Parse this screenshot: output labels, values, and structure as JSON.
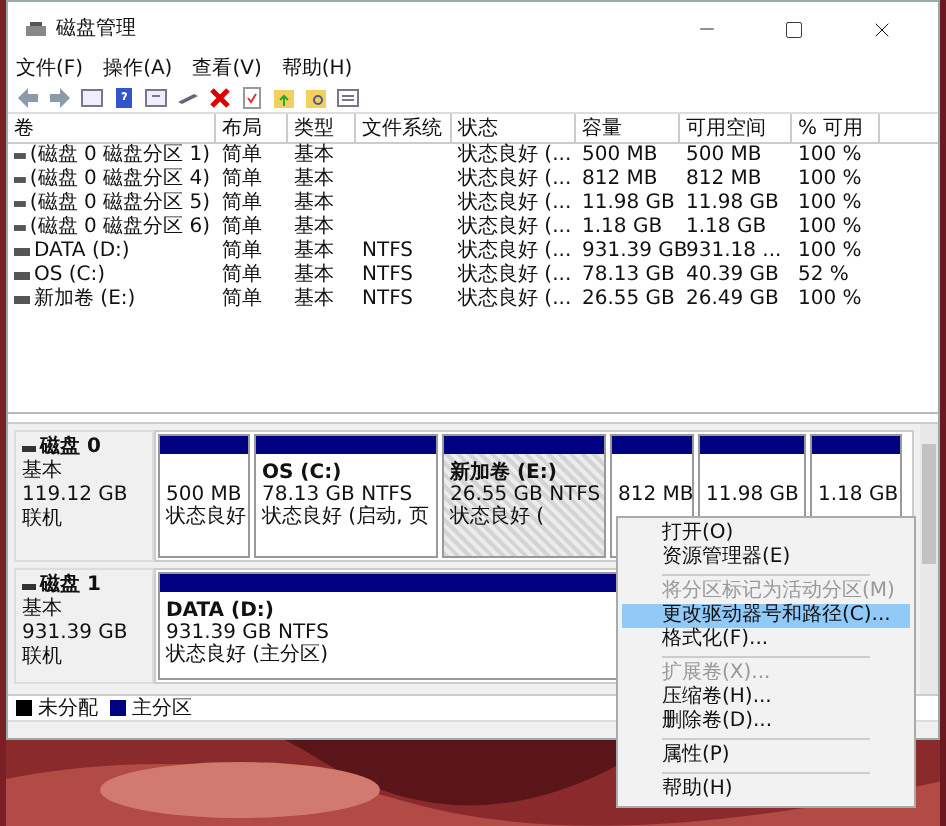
{
  "window": {
    "title": "磁盘管理"
  },
  "menu": [
    "文件(F)",
    "操作(A)",
    "查看(V)",
    "帮助(H)"
  ],
  "table": {
    "columns": [
      "卷",
      "布局",
      "类型",
      "文件系统",
      "状态",
      "容量",
      "可用空间",
      "% 可用"
    ],
    "rows": [
      {
        "volume": "(磁盘 0 磁盘分区 1)",
        "layout": "简单",
        "type": "基本",
        "status": "状态良好 (...",
        "capacity": "500 MB",
        "free": "500 MB",
        "percent": "100 %"
      },
      {
        "volume": "(磁盘 0 磁盘分区 4)",
        "layout": "简单",
        "type": "基本",
        "status": "状态良好 (...",
        "capacity": "812 MB",
        "free": "812 MB",
        "percent": "100 %"
      },
      {
        "volume": "(磁盘 0 磁盘分区 5)",
        "layout": "简单",
        "type": "基本",
        "status": "状态良好 (...",
        "capacity": "11.98 GB",
        "free": "11.98 GB",
        "percent": "100 %"
      },
      {
        "volume": "(磁盘 0 磁盘分区 6)",
        "layout": "简单",
        "type": "基本",
        "status": "状态良好 (...",
        "capacity": "1.18 GB",
        "free": "1.18 GB",
        "percent": "100 %"
      },
      {
        "volume": "DATA (D:)",
        "layout": "简单",
        "type": "基本",
        "file_system": "NTFS",
        "status": "状态良好 (...",
        "capacity": "931.39 GB",
        "free": "931.18 ...",
        "percent": "100 %"
      },
      {
        "volume": "OS (C:)",
        "layout": "简单",
        "type": "基本",
        "file_system": "NTFS",
        "status": "状态良好 (...",
        "capacity": "78.13 GB",
        "free": "40.39 GB",
        "percent": "52 %"
      },
      {
        "volume": "新加卷 (E:)",
        "layout": "简单",
        "type": "基本",
        "file_system": "NTFS",
        "status": "状态良好 (...",
        "capacity": "26.55 GB",
        "free": "26.49 GB",
        "percent": "100 %"
      }
    ]
  },
  "disks": [
    {
      "name": "磁盘 0",
      "type": "基本",
      "size": "119.12 GB",
      "state": "联机",
      "partitions": [
        {
          "lines": [
            "500 MB",
            "状态良好"
          ],
          "selected": false
        },
        {
          "title": "OS  (C:)",
          "lines": [
            "78.13 GB NTFS",
            "状态良好 (启动, 页"
          ],
          "selected": false
        },
        {
          "title": "新加卷  (E:)",
          "lines": [
            "26.55 GB NTFS",
            "状态良好 ("
          ],
          "selected": true
        },
        {
          "lines": [
            "812 MB"
          ],
          "selected": false
        },
        {
          "lines": [
            "11.98 GB"
          ],
          "selected": false
        },
        {
          "lines": [
            "1.18 GB"
          ],
          "selected": false
        }
      ]
    },
    {
      "name": "磁盘 1",
      "type": "基本",
      "size": "931.39 GB",
      "state": "联机",
      "partitions": [
        {
          "title": "DATA  (D:)",
          "lines": [
            "931.39 GB NTFS",
            "状态良好 (主分区)"
          ],
          "selected": false
        }
      ]
    }
  ],
  "legend": [
    {
      "label": "未分配",
      "color": "#000000"
    },
    {
      "label": "主分区",
      "color": "#000080"
    }
  ],
  "context_menu": [
    {
      "kind": "item",
      "label": "打开(O)",
      "disabled": false,
      "selected": false
    },
    {
      "kind": "item",
      "label": "资源管理器(E)",
      "disabled": false,
      "selected": false
    },
    {
      "kind": "separator"
    },
    {
      "kind": "item",
      "label": "将分区标记为活动分区(M)",
      "disabled": true,
      "selected": false
    },
    {
      "kind": "item",
      "label": "更改驱动器号和路径(C)...",
      "disabled": false,
      "selected": true
    },
    {
      "kind": "item",
      "label": "格式化(F)...",
      "disabled": false,
      "selected": false
    },
    {
      "kind": "separator"
    },
    {
      "kind": "item",
      "label": "扩展卷(X)...",
      "disabled": true,
      "selected": false
    },
    {
      "kind": "item",
      "label": "压缩卷(H)...",
      "disabled": false,
      "selected": false
    },
    {
      "kind": "item",
      "label": "删除卷(D)...",
      "disabled": false,
      "selected": false
    },
    {
      "kind": "separator"
    },
    {
      "kind": "item",
      "label": "属性(P)",
      "disabled": false,
      "selected": false
    },
    {
      "kind": "separator"
    },
    {
      "kind": "item",
      "label": "帮助(H)",
      "disabled": false,
      "selected": false
    }
  ]
}
